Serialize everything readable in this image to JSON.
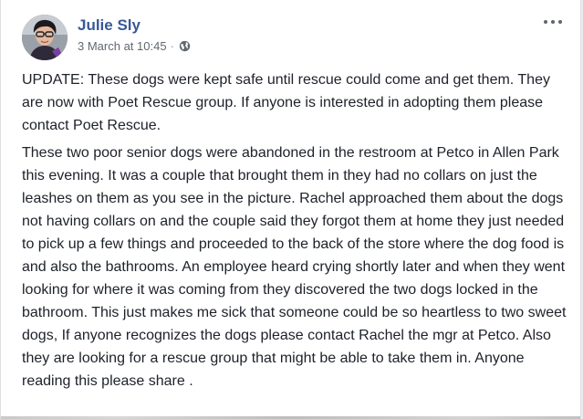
{
  "post": {
    "author": "Julie Sly",
    "timestamp": "3 March at 10:45",
    "separator": "·",
    "privacy_icon": "globe-icon",
    "menu_icon": "more-options-icon",
    "paragraphs": [
      "UPDATE: These dogs were kept safe until rescue could come and get them. They are now with Poet Rescue group. If anyone is interested in adopting them please contact Poet Rescue.",
      "These two poor senior dogs were abandoned in the restroom at Petco in Allen Park this evening. It was a couple that brought them in they had no collars on just the leashes on them as you see in the picture. Rachel approached them about the dogs not having collars on and the couple said they forgot them at home they just needed to pick up a few things and proceeded to the back of the store where the dog food is and also the bathrooms. An employee heard crying shortly later and when they went looking for where it was coming from they discovered the two dogs locked in the bathroom. This just makes me sick that someone could be so heartless to two sweet dogs, If anyone recognizes the dogs please contact Rachel the mgr at Petco. Also they are looking for a rescue group that might be able to take them in. Anyone reading this please share ."
    ]
  },
  "colors": {
    "author_link": "#385898",
    "meta_text": "#616770",
    "body_text": "#1d2129",
    "card_bg": "#ffffff",
    "page_bg": "#e9ebee"
  }
}
